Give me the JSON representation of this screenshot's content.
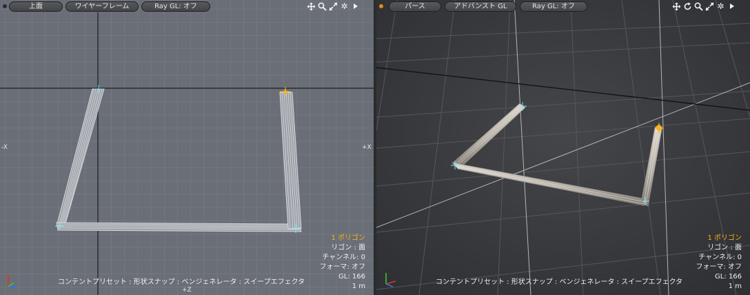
{
  "left_viewport": {
    "view_label": "上面",
    "shading_label": "ワイヤーフレーム",
    "raygl_label": "Ray GL: オフ",
    "axis_left": "-X",
    "axis_right": "+X",
    "axis_bottom": "+Z",
    "info": {
      "polygons": "1 ポリゴン",
      "polygon_mode": "リゴン : 面",
      "channel": "チャンネル: 0",
      "deformers": "フォーマ: オフ",
      "gl": "GL: 166",
      "scale": "1 m"
    },
    "status_bar": "コンテントプリセット : 形状スナップ : ベンジェネレータ : スイープエフェクタ"
  },
  "right_viewport": {
    "view_label": "パース",
    "shading_label": "アドバンスト GL",
    "raygl_label": "Ray GL: オフ",
    "info": {
      "polygons": "1 ポリゴン",
      "polygon_mode": "リゴン : 面",
      "channel": "チャンネル: 0",
      "deformers": "フォーマ: オフ",
      "gl": "GL: 166",
      "scale": "1 m"
    },
    "status_bar": "コンテントプリセット : 形状スナップ : ベンジェネレータ : スイープエフェクタ"
  },
  "colors": {
    "left_background": "#6a6e76",
    "right_background": "#3b3c3f",
    "selection_accent": "#f4b41a",
    "axis_x_red": "#d43a2f",
    "axis_y_green": "#3ec43e",
    "axis_z_blue": "#3a72e0"
  },
  "icons": [
    "move-view-icon",
    "rotate-view-icon",
    "zoom-view-icon",
    "maximize-view-icon",
    "gear-icon",
    "play-arrow-icon"
  ]
}
